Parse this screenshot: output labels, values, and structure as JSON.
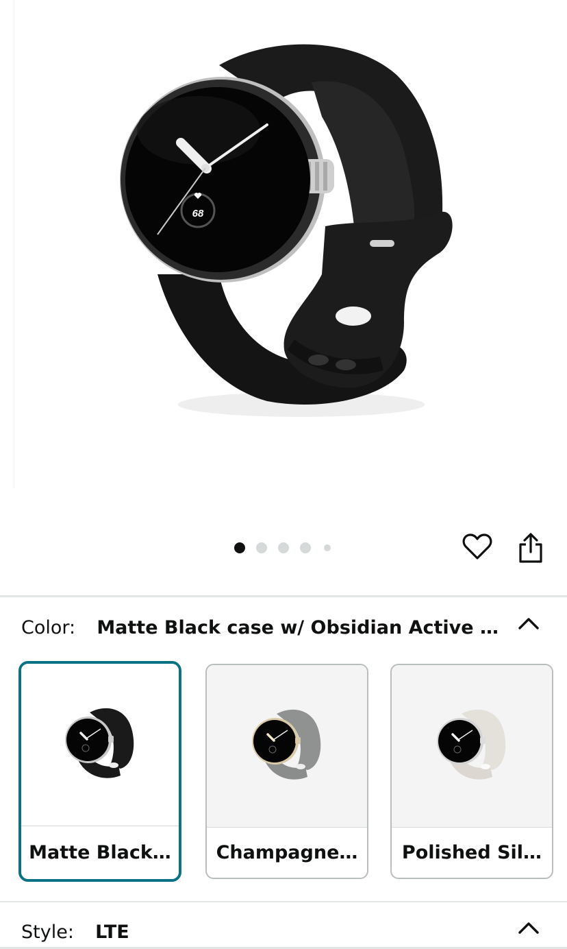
{
  "gallery": {
    "image_count": 5,
    "active_index": 0,
    "watch_face_reading": "68"
  },
  "actions": {
    "wishlist_icon": "heart-icon",
    "share_icon": "share-icon"
  },
  "color_selector": {
    "label": "Color:",
    "value": "Matte Black case w/ Obsidian Active …",
    "options": [
      {
        "label": "Matte Black…",
        "selected": true,
        "band_color": "#1a1a1a"
      },
      {
        "label": "Champagne…",
        "selected": false,
        "band_color": "#8f9290"
      },
      {
        "label": "Polished Sil…",
        "selected": false,
        "band_color": "#e4e0da"
      }
    ]
  },
  "style_selector": {
    "label": "Style:",
    "value": "LTE"
  },
  "colors": {
    "selected_border": "#0b7285",
    "divider": "#e3e6e6"
  }
}
